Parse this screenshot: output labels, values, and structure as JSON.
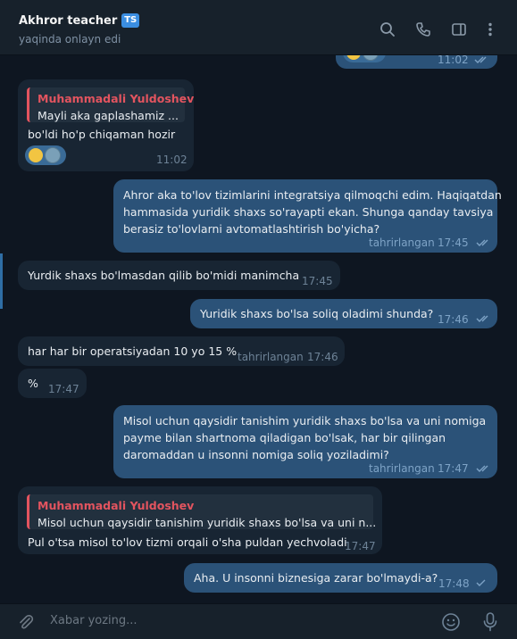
{
  "header": {
    "contact_name": "Akhror teacher",
    "tag": "TS",
    "status": "yaqinda onlayn edi",
    "icons": [
      "search-icon",
      "phone-icon",
      "sidebar-icon",
      "more-icon"
    ]
  },
  "messages": [
    {
      "dir": "out",
      "time": "11:02",
      "reaction": true,
      "ticks": "double"
    },
    {
      "dir": "in",
      "reply_name": "Muhammadali Yuldoshev",
      "reply_text": "Mayli aka gaplashamiz ...",
      "lines": [
        "bo'ldi ho'p chiqaman hozir"
      ],
      "time": "11:02",
      "reaction": true
    },
    {
      "dir": "out",
      "lines": [
        "Ahror aka to'lov tizimlarini integratsiya qilmoqchi edim. Haqiqatdan",
        "hammasida yuridik shaxs so'rayapti ekan. Shunga qanday tavsiya",
        "berasiz to'lovlarni avtomatlashtirish bo'yicha?"
      ],
      "edited": "tahrirlangan",
      "time": "17:45",
      "ticks": "double"
    },
    {
      "dir": "in",
      "lines": [
        "Yurdik shaxs bo'lmasdan qilib bo'midi manimcha"
      ],
      "time": "17:45"
    },
    {
      "dir": "out",
      "lines": [
        "Yuridik shaxs bo'lsa soliq oladimi shunda?"
      ],
      "time": "17:46",
      "ticks": "double"
    },
    {
      "dir": "in",
      "lines": [
        "har har bir operatsiyadan 10 yo 15 %"
      ],
      "edited": "tahrirlangan",
      "time": "17:46"
    },
    {
      "dir": "in",
      "lines": [
        "%"
      ],
      "time": "17:47"
    },
    {
      "dir": "out",
      "lines": [
        "Misol uchun qaysidir tanishim yuridik shaxs bo'lsa va uni nomiga",
        "payme bilan shartnoma qiladigan bo'lsak, har bir qilingan",
        "daromaddan u insonni nomiga soliq yoziladimi?"
      ],
      "edited": "tahrirlangan",
      "time": "17:47",
      "ticks": "double"
    },
    {
      "dir": "in",
      "reply_name": "Muhammadali Yuldoshev",
      "reply_text": "Misol uchun qaysidir tanishim yuridik shaxs bo'lsa va uni n...",
      "lines": [
        "Pul o'tsa misol to'lov tizmi orqali o'sha puldan yechvoladi"
      ],
      "time": "17:47"
    },
    {
      "dir": "out",
      "lines": [
        "Aha. U insonni biznesiga zarar bo'lmaydi-a?"
      ],
      "time": "17:48",
      "ticks": "single"
    }
  ],
  "composer": {
    "placeholder": "Xabar yozing...",
    "icons": [
      "attach-icon",
      "emoji-icon",
      "microphone-icon"
    ]
  }
}
